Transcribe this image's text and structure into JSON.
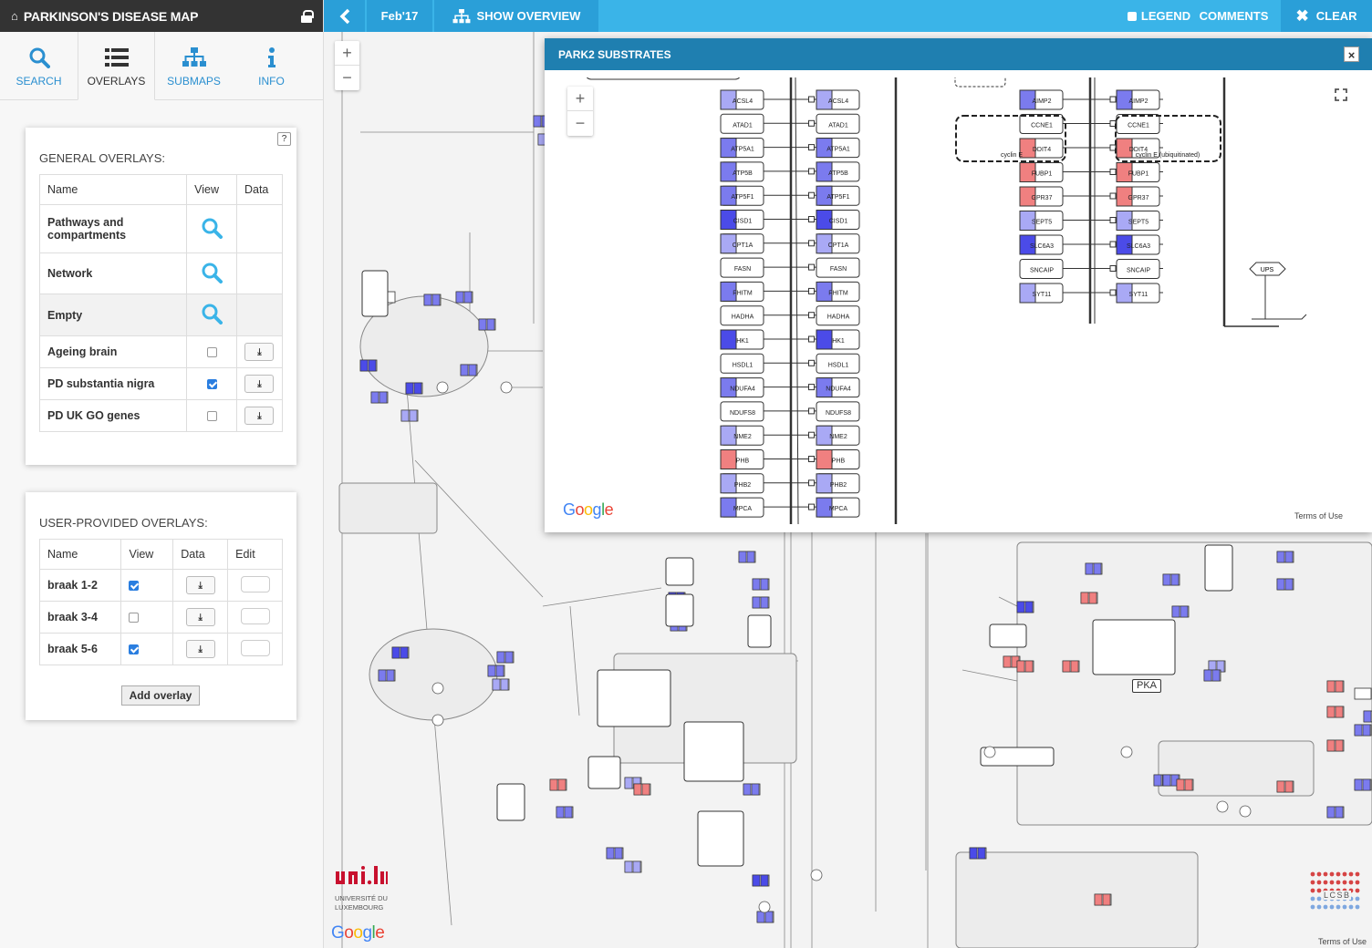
{
  "app": {
    "title": "PARKINSON'S DISEASE MAP",
    "home_icon": "home-icon",
    "lock_icon": "lock-icon"
  },
  "tabs": [
    {
      "label": "SEARCH",
      "icon": "search-icon"
    },
    {
      "label": "OVERLAYS",
      "icon": "list-icon"
    },
    {
      "label": "SUBMAPS",
      "icon": "sitemap-icon"
    },
    {
      "label": "INFO",
      "icon": "info-icon"
    }
  ],
  "general_overlays": {
    "title": "GENERAL OVERLAYS:",
    "help": "?",
    "columns": [
      "Name",
      "View",
      "Data"
    ],
    "rows": [
      {
        "name": "Pathways and compartments",
        "type": "search"
      },
      {
        "name": "Network",
        "type": "search"
      },
      {
        "name": "Empty",
        "type": "search"
      },
      {
        "name": "Ageing brain",
        "type": "check",
        "checked": false
      },
      {
        "name": "PD substantia nigra",
        "type": "check",
        "checked": true
      },
      {
        "name": "PD UK GO genes",
        "type": "check",
        "checked": false
      }
    ]
  },
  "user_overlays": {
    "title": "USER-PROVIDED OVERLAYS:",
    "columns": [
      "Name",
      "View",
      "Data",
      "Edit"
    ],
    "rows": [
      {
        "name": "braak 1-2",
        "checked": true
      },
      {
        "name": "braak 3-4",
        "checked": false
      },
      {
        "name": "braak 5-6",
        "checked": true
      }
    ],
    "add_button": "Add overlay"
  },
  "topbar": {
    "back_icon": "chevron-left-icon",
    "version": "Feb'17",
    "overview": "SHOW OVERVIEW",
    "legend": "LEGEND",
    "comments": "COMMENTS",
    "clear": "CLEAR",
    "legend_checked": false,
    "comments_checked": false
  },
  "map": {
    "zoom_in": "+",
    "zoom_out": "−",
    "google": "Google",
    "terms": "Terms of Use",
    "univ_logo": [
      "UNIVERSITÉ DU",
      "LUXEMBOURG"
    ],
    "lcsb_logo": "LCSB",
    "labels": [
      "PKA",
      "UPS"
    ]
  },
  "popup": {
    "title": "PARK2 SUBSTRATES",
    "close": "×",
    "google": "Google",
    "terms": "Terms of Use",
    "column_a": [
      "ACSL4",
      "ATAD1",
      "ATP5A1",
      "ATP5B",
      "ATP5F1",
      "CISD1",
      "CPT1A",
      "FASN",
      "FHITM",
      "HADHA",
      "HK1",
      "HSDL1",
      "NDUFA4",
      "NDUFS8",
      "NME2",
      "PHB",
      "PHB2",
      "MPCA"
    ],
    "column_b": [
      "ACSL4",
      "ATAD1",
      "ATP5A1",
      "ATP5B",
      "ATP5F1",
      "CISD1",
      "CPT1A",
      "FASN",
      "FHITM",
      "HADHA",
      "HK1",
      "HSDL1",
      "NDUFA4",
      "NDUFS8",
      "NME2",
      "PHB",
      "PHB2",
      "MPCA"
    ],
    "column_c": [
      "AIMP2",
      "CCNE1",
      "DDIT4",
      "FUBP1",
      "GPR37",
      "SEPT5",
      "SLC6A3",
      "SNCAIP",
      "SYT11"
    ],
    "column_d": [
      "AIMP2",
      "CCNE1",
      "DDIT4",
      "FUBP1",
      "GPR37",
      "SEPT5",
      "SLC6A3",
      "SNCAIP",
      "SYT11"
    ],
    "cyclin_a": "cyclin E",
    "cyclin_b": "cyclin E (ubiquitinated)",
    "ups": "UPS"
  },
  "colors": {
    "blue_light": "#a9a9f5",
    "blue_mid": "#7b7bee",
    "blue_dark": "#4b4be8",
    "red": "#f08080",
    "accent": "#3ab4e8"
  }
}
